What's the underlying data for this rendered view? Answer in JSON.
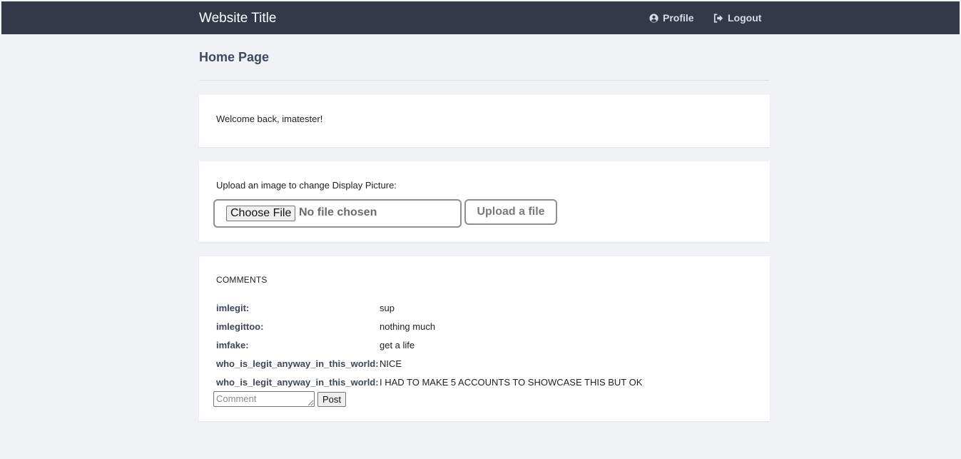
{
  "navbar": {
    "brand": "Website Title",
    "links": [
      {
        "label": "Profile",
        "icon": "user-circle-icon"
      },
      {
        "label": "Logout",
        "icon": "sign-out-icon"
      }
    ],
    "background": "#323a4a"
  },
  "page": {
    "title": "Home Page",
    "background": "#f1f2f6"
  },
  "welcome": {
    "text": "Welcome back, imatester!"
  },
  "upload": {
    "label": "Upload an image to change Display Picture:",
    "choose_button": "Choose File",
    "file_status": "No file chosen",
    "submit_button": "Upload a file"
  },
  "comments": {
    "heading": "COMMENTS",
    "items": [
      {
        "author": "imlegit:",
        "text": "sup"
      },
      {
        "author": "imlegittoo:",
        "text": "nothing much"
      },
      {
        "author": "imfake:",
        "text": "get a life"
      },
      {
        "author": "who_is_legit_anyway_in_this_world:",
        "text": "NICE"
      },
      {
        "author": "who_is_legit_anyway_in_this_world:",
        "text": "I HAD TO MAKE 5 ACCOUNTS TO SHOWCASE THIS BUT OK"
      }
    ],
    "input_placeholder": "Comment",
    "input_value": "",
    "post_button": "Post"
  }
}
